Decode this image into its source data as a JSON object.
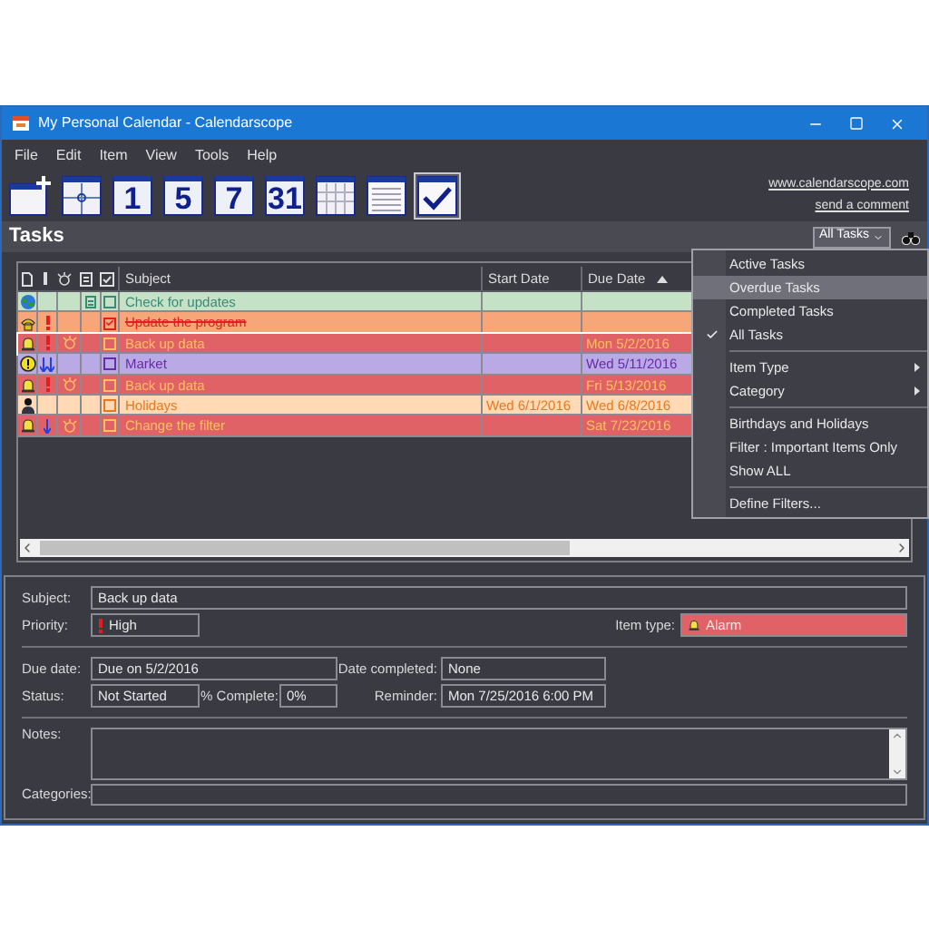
{
  "window": {
    "title": "My Personal Calendar - Calendarscope"
  },
  "menu_bar": [
    "File",
    "Edit",
    "Item",
    "View",
    "Tools",
    "Help"
  ],
  "toolbar": [
    {
      "kind": "new",
      "selected": false
    },
    {
      "kind": "cross",
      "selected": false
    },
    {
      "kind": "day",
      "label": "1",
      "selected": false
    },
    {
      "kind": "day",
      "label": "5",
      "selected": false
    },
    {
      "kind": "day",
      "label": "7",
      "selected": false
    },
    {
      "kind": "day",
      "label": "31",
      "selected": false
    },
    {
      "kind": "grid",
      "selected": false
    },
    {
      "kind": "list",
      "selected": false
    },
    {
      "kind": "tasks",
      "selected": true
    }
  ],
  "links": [
    "www.calendarscope.com",
    "send a comment"
  ],
  "section_title": "Tasks",
  "filter_button": "All Tasks",
  "table": {
    "columns": [
      {
        "label": "Subject"
      },
      {
        "label": "Start Date"
      },
      {
        "label": "Due Date",
        "sort": {
          "kind": "ascending"
        }
      }
    ],
    "rows": [
      {
        "kind": "update",
        "alarm": false,
        "note": true,
        "done": false,
        "subject": "Check for updates",
        "color": "#c6e2c6",
        "selected": false
      },
      {
        "kind": "phone",
        "priority": {
          "kind": "high"
        },
        "alarm": false,
        "note": false,
        "done": true,
        "subject": "Update the program",
        "color": "#f7a67a",
        "selected": false
      },
      {
        "kind": "alarm",
        "priority": {
          "kind": "high"
        },
        "alarm": true,
        "note": false,
        "done": false,
        "subject": "Back up data",
        "due_date": "Mon 5/2/2016",
        "color": "#e06266",
        "selected": true
      },
      {
        "kind": "important",
        "priority": {
          "kind": "lowest"
        },
        "alarm": false,
        "note": false,
        "done": false,
        "subject": "Market",
        "due_date": "Wed 5/11/2016",
        "color": "#b9a9e5",
        "selected": false
      },
      {
        "kind": "alarm",
        "priority": {
          "kind": "high"
        },
        "alarm": true,
        "note": false,
        "done": false,
        "subject": "Back up data",
        "due_date": "Fri 5/13/2016",
        "color": "#e06266",
        "selected": false
      },
      {
        "kind": "holiday",
        "alarm": false,
        "note": false,
        "done": false,
        "subject": "Holidays",
        "start_date": "Wed 6/1/2016",
        "due_date": "Wed 6/8/2016",
        "color": "#ffdab4",
        "selected": false
      },
      {
        "kind": "alarm",
        "priority": {
          "kind": "low"
        },
        "alarm": true,
        "note": false,
        "done": false,
        "subject": "Change the filter",
        "due_date": "Sat 7/23/2016",
        "color": "#e06266",
        "selected": false
      }
    ]
  },
  "filter_menu": [
    {
      "kind": "item",
      "label": "Active Tasks",
      "checked": false,
      "selected": false
    },
    {
      "kind": "item",
      "label": "Overdue Tasks",
      "checked": false,
      "selected": true
    },
    {
      "kind": "item",
      "label": "Completed Tasks",
      "checked": false,
      "selected": false
    },
    {
      "kind": "item",
      "label": "All Tasks",
      "checked": true,
      "selected": false
    },
    {
      "kind": "separator"
    },
    {
      "kind": "submenu",
      "label": "Item Type",
      "checked": false,
      "selected": false
    },
    {
      "kind": "submenu",
      "label": "Category",
      "checked": false,
      "selected": false
    },
    {
      "kind": "separator"
    },
    {
      "kind": "item",
      "label": "Birthdays and Holidays",
      "checked": false,
      "selected": false
    },
    {
      "kind": "item",
      "label": "Filter : Important Items Only",
      "checked": false,
      "selected": false
    },
    {
      "kind": "item",
      "label": "Show ALL",
      "checked": false,
      "selected": false
    },
    {
      "kind": "separator"
    },
    {
      "kind": "item",
      "label": "Define Filters...",
      "checked": false,
      "selected": false
    }
  ],
  "details": {
    "subject_label": "Subject:",
    "subject": "Back up data",
    "priority_label": "Priority:",
    "priority": "High",
    "item_type_label": "Item type:",
    "item_type": {
      "label": "Alarm",
      "color": "#e06266"
    },
    "due_label": "Due date:",
    "due": "Due on 5/2/2016",
    "completed_label": "Date completed:",
    "completed": "None",
    "status_label": "Status:",
    "status": "Not Started",
    "percent_label": "% Complete:",
    "percent": "0%",
    "reminder_label": "Reminder:",
    "reminder": "Mon 7/25/2016 6:00 PM",
    "notes_label": "Notes:",
    "categories_label": "Categories:"
  }
}
